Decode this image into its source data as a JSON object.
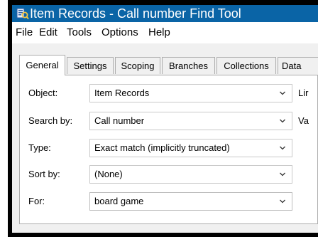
{
  "window": {
    "title": "Item Records - Call number Find Tool"
  },
  "menu": [
    "File",
    "Edit",
    "Tools",
    "Options",
    "Help"
  ],
  "tabs": [
    {
      "label": "General",
      "active": true
    },
    {
      "label": "Settings",
      "active": false
    },
    {
      "label": "Scoping",
      "active": false
    },
    {
      "label": "Branches",
      "active": false
    },
    {
      "label": "Collections",
      "active": false
    },
    {
      "label": "Data",
      "active": false
    }
  ],
  "form": {
    "object": {
      "label": "Object:",
      "value": "Item Records",
      "side_label": "Lir"
    },
    "search_by": {
      "label": "Search by:",
      "value": "Call number",
      "side_label": "Va"
    },
    "type": {
      "label": "Type:",
      "value": "Exact match (implicitly truncated)"
    },
    "sort_by": {
      "label": "Sort by:",
      "value": "(None)"
    },
    "for": {
      "label": "For:",
      "value": "board game"
    }
  },
  "icons": {
    "app": "app-icon",
    "dropdown": "chevron-down-icon"
  },
  "colors": {
    "titlebar": "#0a64a6",
    "frame": "#000000",
    "panel": "#ffffff",
    "background": "#f0f0f0"
  }
}
